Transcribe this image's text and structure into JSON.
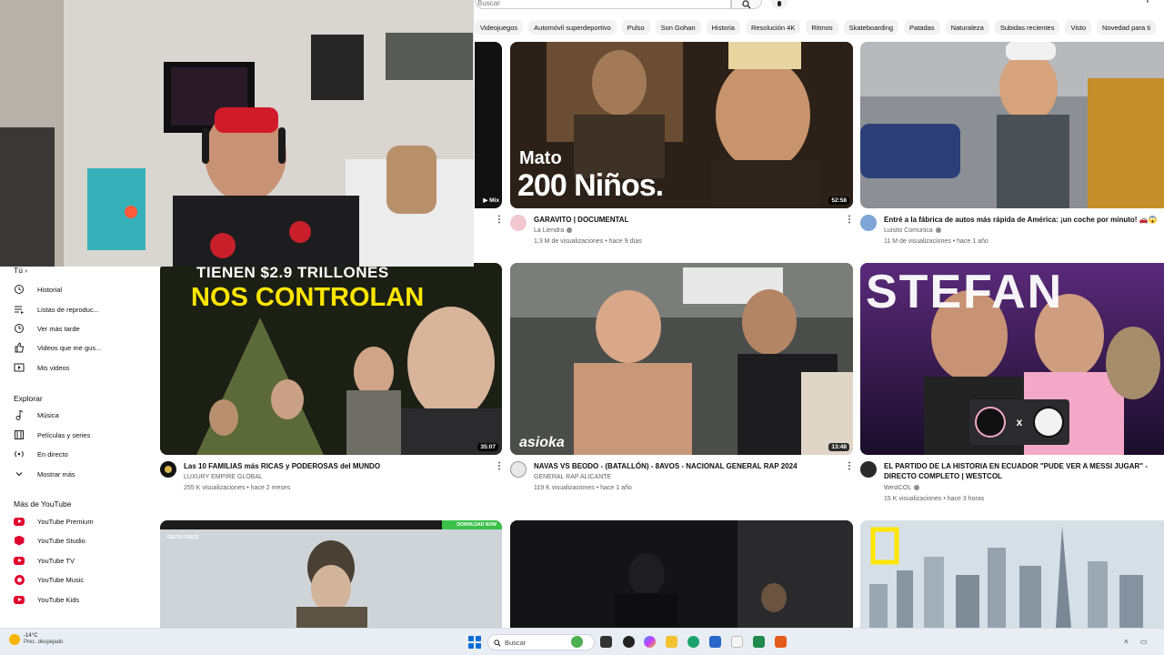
{
  "search": {
    "placeholder": "Buscar"
  },
  "chips": [
    "Videojuegos",
    "Automóvil superdeportivo",
    "Pulso",
    "Son Gohan",
    "Historia",
    "Resolución 4K",
    "Ritmos",
    "Skateboarding",
    "Patadas",
    "Naturaleza",
    "Subidas recientes",
    "Visto",
    "Novedad para ti"
  ],
  "sidebar": {
    "you_label": "Tú",
    "you_items": [
      "Historial",
      "Listas de reproduc...",
      "Ver más tarde",
      "Videos que me gus...",
      "Mis videos"
    ],
    "explore_title": "Explorar",
    "explore_items": [
      "Música",
      "Películas y series",
      "En directo",
      "Mostrar más"
    ],
    "more_title": "Más de YouTube",
    "more_items": [
      "YouTube Premium",
      "YouTube Studio",
      "YouTube TV",
      "YouTube Music",
      "YouTube Kids"
    ]
  },
  "videos": [
    {
      "title": "GARAVITO | DOCUMENTAL",
      "channel": "La Liendra",
      "meta": "1,3 M de visualizaciones • hace 9 días",
      "duration": "52:58",
      "overlay_line1": "Mato",
      "overlay_line2": "200 Niños."
    },
    {
      "title": "Entré a la fábrica de autos más rápida de América: ¡un coche por minuto! 🚗😱",
      "channel": "Luisito Comunica",
      "meta": "11 M de visualizaciones • hace 1 año",
      "duration": ""
    },
    {
      "title": "Las 10 FAMILIAS más RICAS y PODEROSAS del MUNDO",
      "channel": "LUXURY EMPIRE GLOBAL",
      "meta": "255 K visualizaciones • hace 2 meses",
      "duration": "35:07",
      "overlay_line1": "TIENEN $2.9 TRILLONES",
      "overlay_line2": "NOS CONTROLAN"
    },
    {
      "title": "NAVAS VS BEODO - (BATALLÓN) - 8AVOS - NACIONAL GENERAL RAP 2024",
      "channel": "GENERAL RAP ALICANTE",
      "meta": "119 K visualizaciones • hace 1 año",
      "duration": "13:48",
      "brand": "asioka"
    },
    {
      "title": "EL PARTIDO DE LA HISTORIA EN ECUADOR \"PUDE VER A MESSI JUGAR\" - DIRECTO COMPLETO | WESTCOL",
      "channel": "WestCOL",
      "meta": "15 K visualizaciones • hace 3 horas",
      "duration": "",
      "overlay_line1": "STEFAN",
      "badge_text": "x"
    },
    {
      "title": "",
      "channel": "",
      "meta": "",
      "duration": "",
      "overlay_line1": "DELTA FORCE",
      "overlay_line2": "DOWNLOAD NOW"
    },
    {
      "title": "",
      "channel": "",
      "meta": "",
      "duration": ""
    },
    {
      "title": "",
      "channel": "",
      "meta": "",
      "duration": ""
    }
  ],
  "mix_label": "Mix",
  "taskbar": {
    "weather_temp": "-14°C",
    "weather_cond": "Prec. despejado",
    "search_label": "Buscar"
  },
  "colors": {
    "yt_red": "#e1002d",
    "accent_blue": "#0a6cd6",
    "thumb_yellow": "#ffe600"
  }
}
